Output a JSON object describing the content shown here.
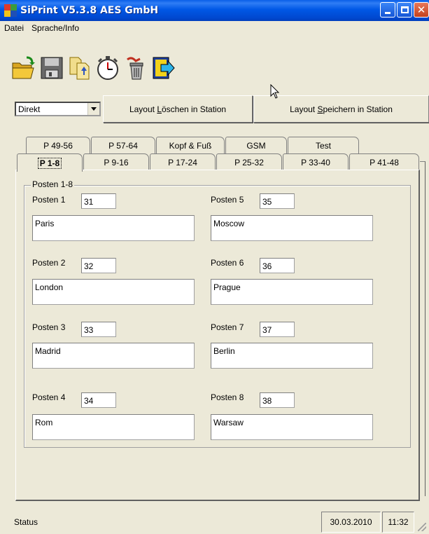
{
  "window": {
    "title": "SiPrint V5.3.8 AES GmbH"
  },
  "menu": [
    "Datei",
    "Sprache/Info"
  ],
  "toolbar": {
    "buttons": [
      {
        "icon": "open-folder-icon"
      },
      {
        "icon": "save-disk-icon"
      },
      {
        "icon": "copy-documents-icon"
      },
      {
        "icon": "stopwatch-icon"
      },
      {
        "icon": "delete-trash-icon"
      },
      {
        "icon": "exit-arrow-icon"
      }
    ]
  },
  "mode_select": {
    "value": "Direkt"
  },
  "actions": {
    "delete_pre": "Layout ",
    "delete_accel": "L",
    "delete_post": "öschen in Station",
    "save_pre": "Layout ",
    "save_accel": "S",
    "save_post": "peichern in Station"
  },
  "tabs_back": [
    "P 49-56",
    "P 57-64",
    "Kopf & Fuß",
    "GSM",
    "Test"
  ],
  "tabs_front": [
    "P 1-8",
    "P 9-16",
    "P 17-24",
    "P 25-32",
    "P 33-40",
    "P 41-48"
  ],
  "active_tab": "P 1-8",
  "group": {
    "label": "Posten 1-8",
    "posten": [
      {
        "label": "Posten 1",
        "number": "31",
        "city": "Paris"
      },
      {
        "label": "Posten 2",
        "number": "32",
        "city": "London"
      },
      {
        "label": "Posten 3",
        "number": "33",
        "city": "Madrid"
      },
      {
        "label": "Posten 4",
        "number": "34",
        "city": "Rom"
      },
      {
        "label": "Posten 5",
        "number": "35",
        "city": "Moscow"
      },
      {
        "label": "Posten 6",
        "number": "36",
        "city": "Prague"
      },
      {
        "label": "Posten 7",
        "number": "37",
        "city": "Berlin"
      },
      {
        "label": "Posten 8",
        "number": "38",
        "city": "Warsaw"
      }
    ]
  },
  "status": {
    "text": "Status",
    "date": "30.03.2010",
    "time": "11:32"
  },
  "colors": {
    "titlebar": "#0058e6",
    "face": "#ece9d8",
    "field": "#ffffff"
  }
}
